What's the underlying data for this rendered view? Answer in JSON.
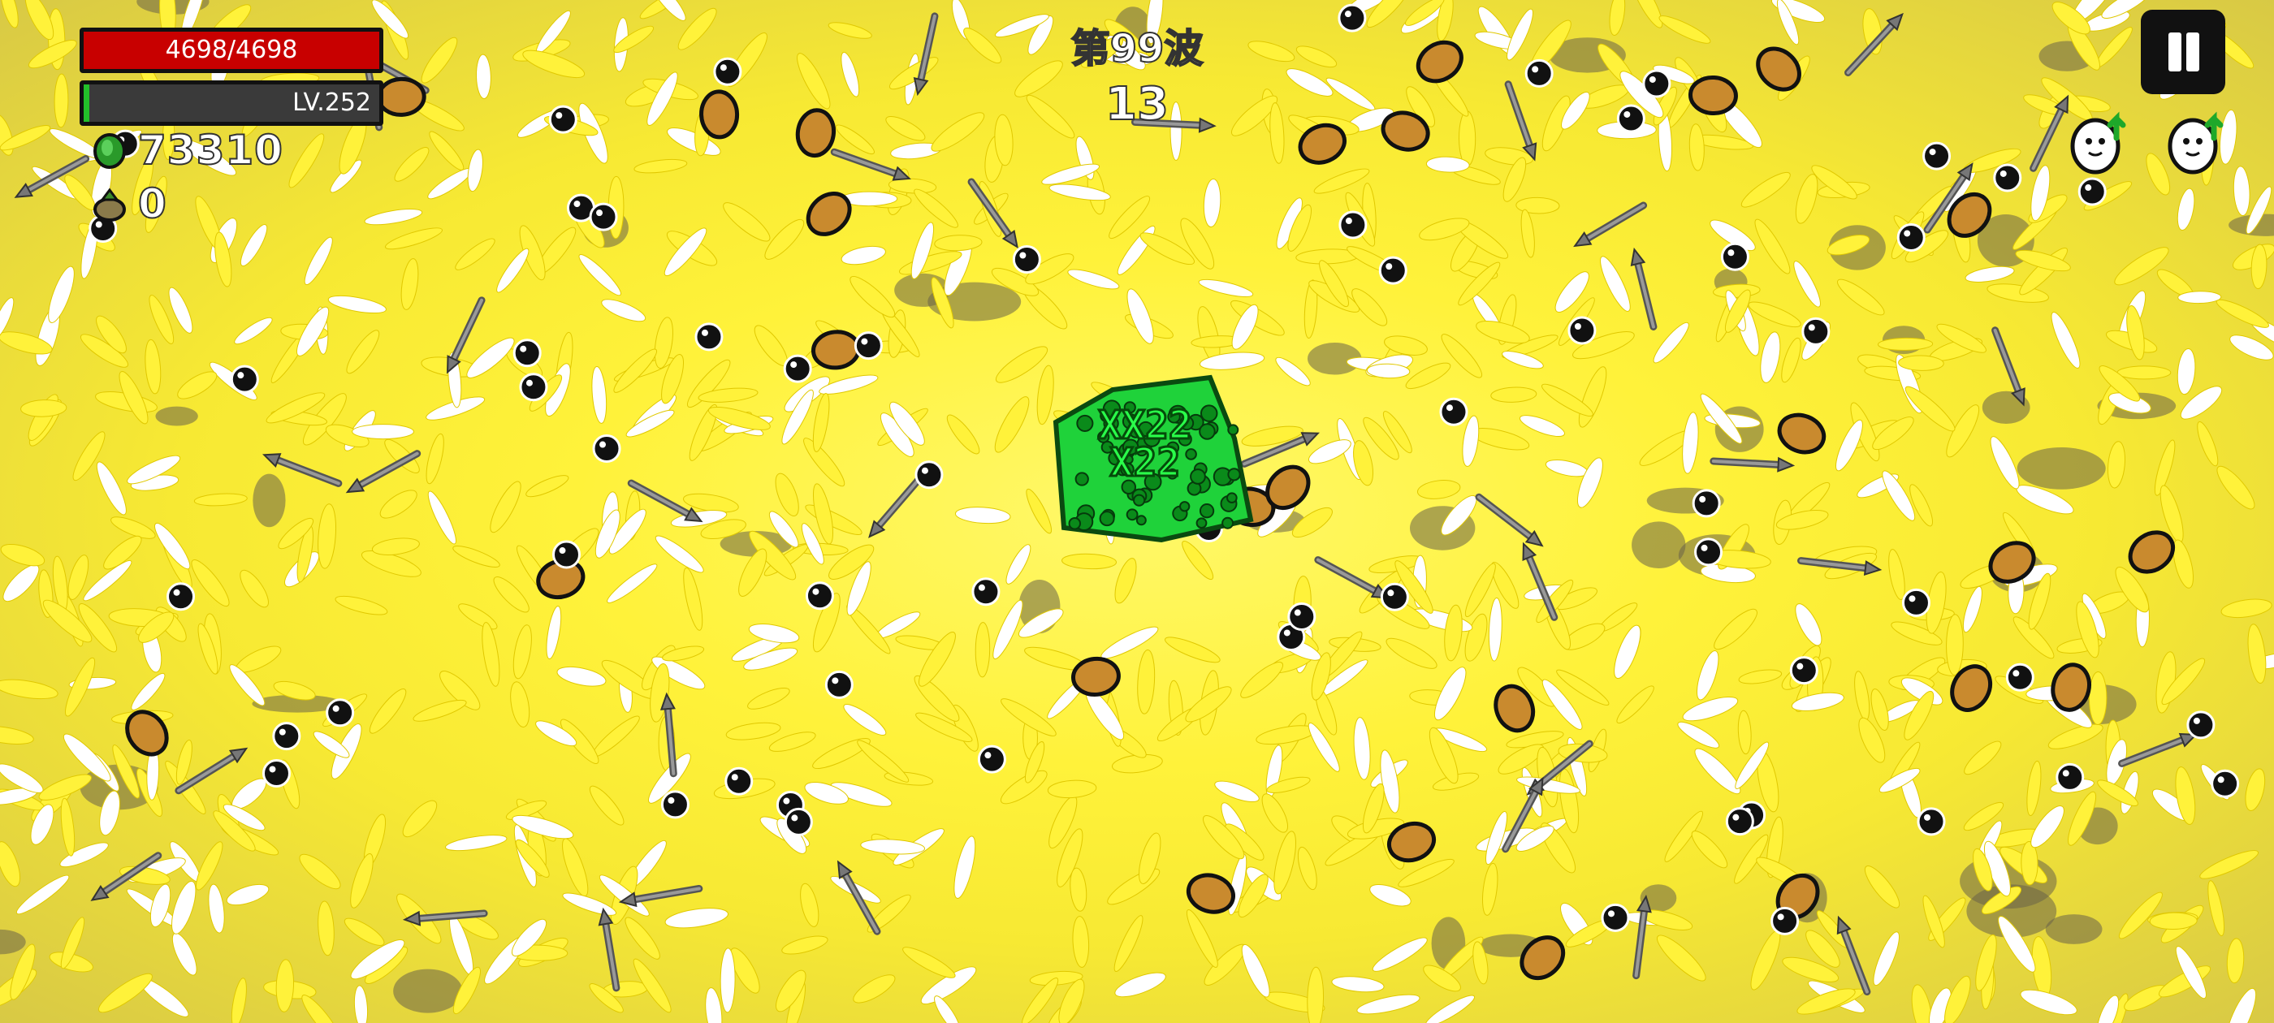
{
  "hud": {
    "hp_text": "4698/4698",
    "hp_fraction": 1.0,
    "level_text": "LV.252",
    "xp_fraction": 0.02,
    "coins": "73310",
    "materials": "0",
    "coin_icon": "green-coin-icon",
    "material_icon": "material-bag-icon"
  },
  "wave": {
    "label": "第99波",
    "timer": "13"
  },
  "pause": {
    "icon": "pause-icon"
  },
  "upgrades": [
    {
      "icon": "level-up-potato-icon"
    },
    {
      "icon": "level-up-potato-icon"
    }
  ],
  "player": {
    "damage_text_1": "XX22",
    "damage_text_2": "X22"
  },
  "colors": {
    "hp_red": "#c80000",
    "xp_green": "#22c02a",
    "projectile_yellow": "#fff23a",
    "player_green": "#1fd23a"
  }
}
